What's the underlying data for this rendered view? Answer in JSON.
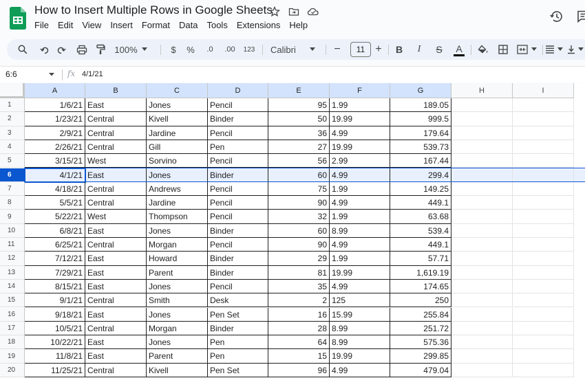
{
  "app": {
    "title": "How to Insert Multiple Rows in Google Sheets",
    "menu": [
      "File",
      "Edit",
      "View",
      "Insert",
      "Format",
      "Data",
      "Tools",
      "Extensions",
      "Help"
    ]
  },
  "toolbar": {
    "zoom": "100%",
    "currency": "$",
    "percent": "%",
    "decrease_decimal": ".0",
    "increase_decimal": ".00",
    "number_format": "123",
    "font": "Calibri",
    "font_size": "11",
    "minus": "−",
    "plus": "+",
    "bold": "B",
    "italic": "I",
    "strike": "S",
    "text_color": "A"
  },
  "formula_bar": {
    "name_box": "6:6",
    "fx": "fx",
    "value": "4/1/21"
  },
  "grid": {
    "columns": [
      "A",
      "B",
      "C",
      "D",
      "E",
      "F",
      "G",
      "H",
      "I"
    ],
    "selected_row": 6,
    "rows": [
      {
        "n": "1",
        "cells": [
          "1/6/21",
          "East",
          "Jones",
          "Pencil",
          "95",
          "1.99",
          "189.05"
        ]
      },
      {
        "n": "2",
        "cells": [
          "1/23/21",
          "Central",
          "Kivell",
          "Binder",
          "50",
          "19.99",
          "999.5"
        ]
      },
      {
        "n": "3",
        "cells": [
          "2/9/21",
          "Central",
          "Jardine",
          "Pencil",
          "36",
          "4.99",
          "179.64"
        ]
      },
      {
        "n": "4",
        "cells": [
          "2/26/21",
          "Central",
          "Gill",
          "Pen",
          "27",
          "19.99",
          "539.73"
        ]
      },
      {
        "n": "5",
        "cells": [
          "3/15/21",
          "West",
          "Sorvino",
          "Pencil",
          "56",
          "2.99",
          "167.44"
        ]
      },
      {
        "n": "6",
        "cells": [
          "4/1/21",
          "East",
          "Jones",
          "Binder",
          "60",
          "4.99",
          "299.4"
        ]
      },
      {
        "n": "7",
        "cells": [
          "4/18/21",
          "Central",
          "Andrews",
          "Pencil",
          "75",
          "1.99",
          "149.25"
        ]
      },
      {
        "n": "8",
        "cells": [
          "5/5/21",
          "Central",
          "Jardine",
          "Pencil",
          "90",
          "4.99",
          "449.1"
        ]
      },
      {
        "n": "9",
        "cells": [
          "5/22/21",
          "West",
          "Thompson",
          "Pencil",
          "32",
          "1.99",
          "63.68"
        ]
      },
      {
        "n": "10",
        "cells": [
          "6/8/21",
          "East",
          "Jones",
          "Binder",
          "60",
          "8.99",
          "539.4"
        ]
      },
      {
        "n": "11",
        "cells": [
          "6/25/21",
          "Central",
          "Morgan",
          "Pencil",
          "90",
          "4.99",
          "449.1"
        ]
      },
      {
        "n": "12",
        "cells": [
          "7/12/21",
          "East",
          "Howard",
          "Binder",
          "29",
          "1.99",
          "57.71"
        ]
      },
      {
        "n": "13",
        "cells": [
          "7/29/21",
          "East",
          "Parent",
          "Binder",
          "81",
          "19.99",
          "1,619.19"
        ]
      },
      {
        "n": "14",
        "cells": [
          "8/15/21",
          "East",
          "Jones",
          "Pencil",
          "35",
          "4.99",
          "174.65"
        ]
      },
      {
        "n": "15",
        "cells": [
          "9/1/21",
          "Central",
          "Smith",
          "Desk",
          "2",
          "125",
          "250"
        ]
      },
      {
        "n": "16",
        "cells": [
          "9/18/21",
          "East",
          "Jones",
          "Pen Set",
          "16",
          "15.99",
          "255.84"
        ]
      },
      {
        "n": "17",
        "cells": [
          "10/5/21",
          "Central",
          "Morgan",
          "Binder",
          "28",
          "8.99",
          "251.72"
        ]
      },
      {
        "n": "18",
        "cells": [
          "10/22/21",
          "East",
          "Jones",
          "Pen",
          "64",
          "8.99",
          "575.36"
        ]
      },
      {
        "n": "19",
        "cells": [
          "11/8/21",
          "East",
          "Parent",
          "Pen",
          "15",
          "19.99",
          "299.85"
        ]
      },
      {
        "n": "20",
        "cells": [
          "11/25/21",
          "Central",
          "Kivell",
          "Pen Set",
          "96",
          "4.99",
          "479.04"
        ]
      }
    ]
  }
}
